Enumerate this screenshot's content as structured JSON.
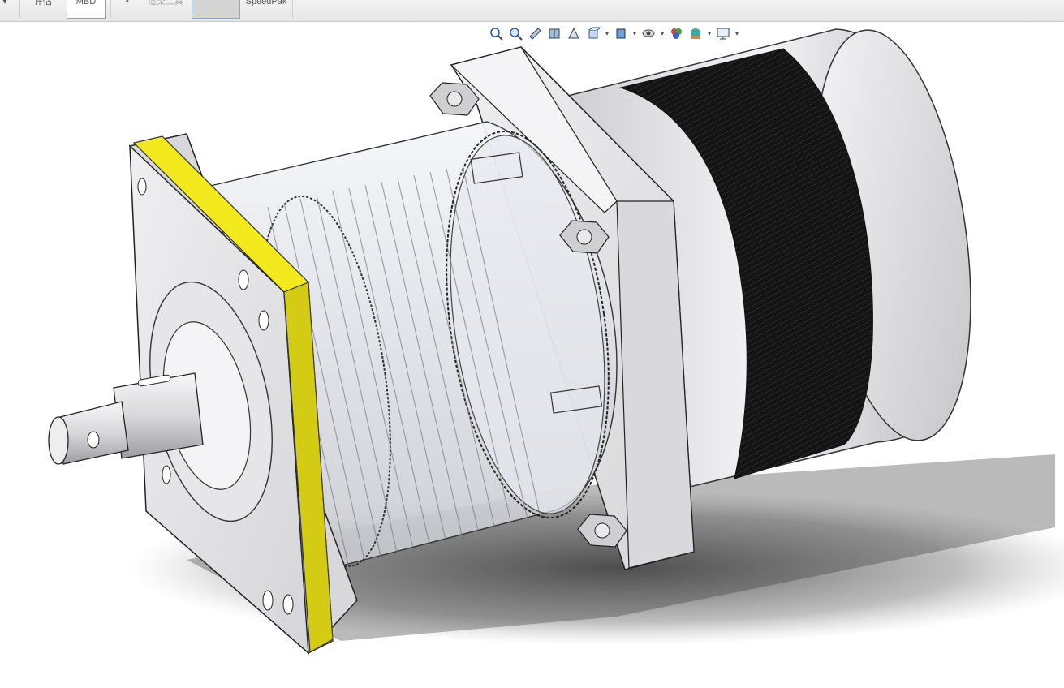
{
  "ribbon": {
    "tabs": [
      {
        "label": "评估",
        "state": "normal"
      },
      {
        "label": "MBD",
        "state": "selected"
      },
      {
        "label": "渲染工具",
        "state": "normal"
      },
      {
        "label": "",
        "state": "greyed"
      },
      {
        "label": "SpeedPak",
        "state": "normal"
      }
    ]
  },
  "heads_up_toolbar": {
    "items": [
      {
        "icon": "zoom-to-fit-icon",
        "dropdown": false
      },
      {
        "icon": "zoom-to-area-icon",
        "dropdown": false
      },
      {
        "icon": "previous-view-icon",
        "dropdown": false
      },
      {
        "icon": "section-view-icon",
        "dropdown": false
      },
      {
        "icon": "dynamic-annotation-views-icon",
        "dropdown": false
      },
      {
        "icon": "view-orientation-icon",
        "dropdown": true
      },
      {
        "icon": "display-style-icon",
        "dropdown": true
      },
      {
        "icon": "hide-show-items-icon",
        "dropdown": true
      },
      {
        "icon": "edit-appearance-icon",
        "dropdown": false
      },
      {
        "icon": "apply-scene-icon",
        "dropdown": true
      },
      {
        "icon": "view-settings-icon",
        "dropdown": true
      }
    ]
  },
  "model": {
    "subject": "stepper-motor-with-planetary-gearbox",
    "colors": {
      "selected_face": "#f2ea1c",
      "housing": "#dcdcde",
      "windings": "#1a1a1a",
      "transparent_gear_body": "#e9ebf0"
    }
  }
}
